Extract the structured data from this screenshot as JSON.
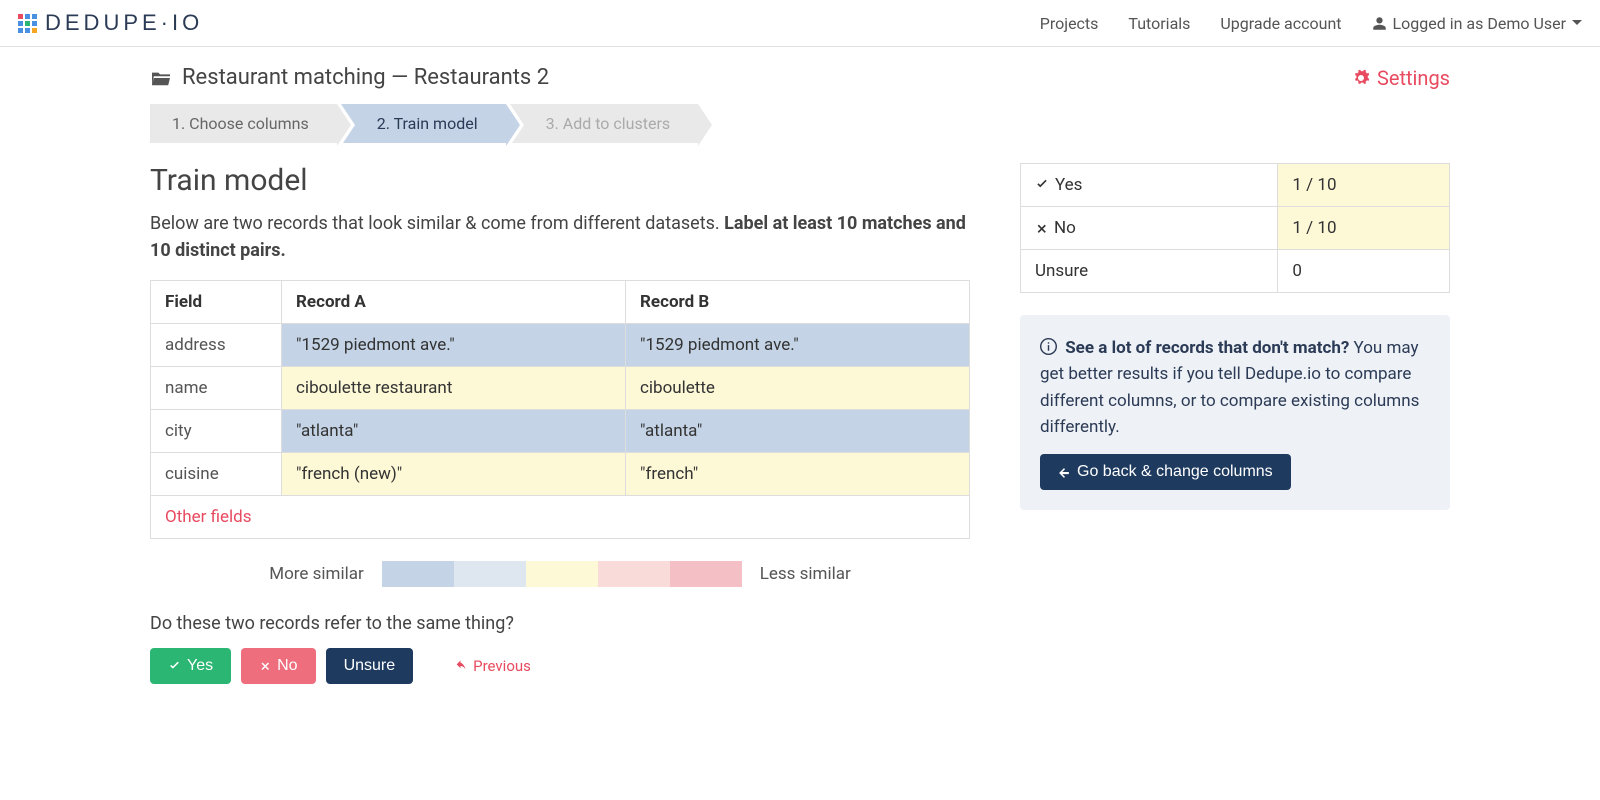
{
  "brand": {
    "name": "DEDUPE·IO"
  },
  "nav": {
    "projects": "Projects",
    "tutorials": "Tutorials",
    "upgrade": "Upgrade account",
    "user_label": "Logged in as Demo User"
  },
  "breadcrumb": {
    "project": "Restaurant matching",
    "dataset": "Restaurants 2",
    "separator": " — "
  },
  "settings_label": "Settings",
  "steps": {
    "s1": "1. Choose columns",
    "s2": "2. Train model",
    "s3": "3. Add to clusters"
  },
  "heading": "Train model",
  "instructions_pre": "Below are two records that look similar & come from different datasets. ",
  "instructions_bold": "Label at least 10 matches and 10 distinct pairs.",
  "table": {
    "headers": {
      "field": "Field",
      "a": "Record A",
      "b": "Record B"
    },
    "rows": [
      {
        "field": "address",
        "a": "\"1529 piedmont ave.\"",
        "b": "\"1529 piedmont ave.\"",
        "sim": 1
      },
      {
        "field": "name",
        "a": "ciboulette restaurant",
        "b": "ciboulette",
        "sim": 2
      },
      {
        "field": "city",
        "a": "\"atlanta\"",
        "b": "\"atlanta\"",
        "sim": 1
      },
      {
        "field": "cuisine",
        "a": "\"french (new)\"",
        "b": "\"french\"",
        "sim": 2
      }
    ],
    "other_fields": "Other fields"
  },
  "legend": {
    "more": "More similar",
    "less": "Less similar",
    "colors": [
      "#c4d4e6",
      "#dee6ef",
      "#fdf8d6",
      "#f9dcd9",
      "#f4bfc5"
    ]
  },
  "question": "Do these two records refer to the same thing?",
  "buttons": {
    "yes": "Yes",
    "no": "No",
    "unsure": "Unsure",
    "previous": "Previous",
    "go_back": "Go back & change columns"
  },
  "tally": {
    "yes_label": "Yes",
    "yes_count": "1 / 10",
    "no_label": "No",
    "no_count": "1 / 10",
    "unsure_label": "Unsure",
    "unsure_count": "0"
  },
  "hint": {
    "bold": "See a lot of records that don't match?",
    "body": " You may get better results if you tell Dedupe.io to compare different columns, or to compare existing columns differently."
  }
}
